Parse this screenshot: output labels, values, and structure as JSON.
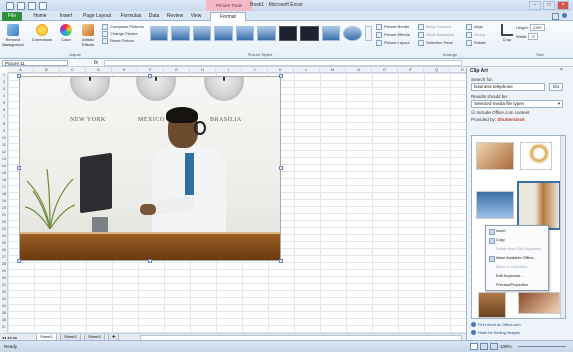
{
  "window": {
    "title": "Book1 - Microsoft Excel",
    "context_tab": "Picture Tools"
  },
  "ribbon": {
    "tabs": [
      "File",
      "Home",
      "Insert",
      "Page Layout",
      "Formulas",
      "Data",
      "Review",
      "View",
      "Format"
    ],
    "buttons": {
      "remove_background": "Remove Background",
      "corrections": "Corrections",
      "color": "Color",
      "artistic_effects": "Artistic Effects",
      "compress": "Compress Pictures",
      "change": "Change Picture",
      "reset": "Reset Picture"
    },
    "adjust_label": "Adjust",
    "styles_label": "Picture Styles",
    "picture_border": "Picture Border",
    "picture_effects": "Picture Effects",
    "picture_layout": "Picture Layout",
    "bring_forward": "Bring Forward",
    "send_backward": "Send Backward",
    "selection_pane": "Selection Pane",
    "align": "Align",
    "group": "Group",
    "rotate": "Rotate",
    "arrange_label": "Arrange",
    "crop": "Crop",
    "height_label": "Height:",
    "height_value": "2.58\"",
    "width_label": "Width:",
    "width_value": "3\"",
    "size_label": "Size"
  },
  "formula_bar": {
    "name_box": "Picture 11",
    "fx": "fx"
  },
  "grid": {
    "columns": [
      "A",
      "B",
      "C",
      "D",
      "E",
      "F",
      "G",
      "H",
      "I",
      "J",
      "K",
      "L",
      "M",
      "N",
      "O",
      "P",
      "Q",
      "R"
    ],
    "rows": [
      "1",
      "2",
      "3",
      "4",
      "5",
      "6",
      "7",
      "8",
      "9",
      "10",
      "11",
      "12",
      "13",
      "14",
      "15",
      "16",
      "17",
      "18",
      "19",
      "20",
      "21",
      "22",
      "23",
      "24",
      "25",
      "26",
      "27",
      "28",
      "29",
      "30",
      "31",
      "32",
      "33",
      "34",
      "35",
      "36",
      "37"
    ]
  },
  "picture": {
    "city_labels": [
      "NEW YORK",
      "MEXICO",
      "BRASILIA"
    ]
  },
  "sheets": [
    "Sheet1",
    "Sheet2",
    "Sheet3"
  ],
  "status": {
    "ready": "Ready",
    "zoom": "100%"
  },
  "clip_art": {
    "title": "Clip Art",
    "search_for_label": "Search for:",
    "search_value": "business telephone",
    "go": "Go",
    "results_label": "Results should be:",
    "results_value": "Selected media file types",
    "include_office": "Include Office.com content",
    "provided_by": "Provided by:",
    "provider": "Shutterstock",
    "menu": [
      {
        "label": "Insert",
        "disabled": false
      },
      {
        "label": "Copy",
        "disabled": false
      },
      {
        "label": "Delete from Clip Organizer",
        "disabled": true
      },
      {
        "label": "Make Available Offline...",
        "disabled": false
      },
      {
        "label": "Move to Collection...",
        "disabled": true
      },
      {
        "label": "Edit Keywords...",
        "disabled": false
      },
      {
        "label": "Preview/Properties",
        "disabled": false
      }
    ],
    "find_more": "Find more at Office.com",
    "hints": "Hints for finding images"
  },
  "colors": {
    "file_tab": "#2f8f3a",
    "context_tab": "#f3b9c9",
    "accent": "#3f7bc0"
  }
}
